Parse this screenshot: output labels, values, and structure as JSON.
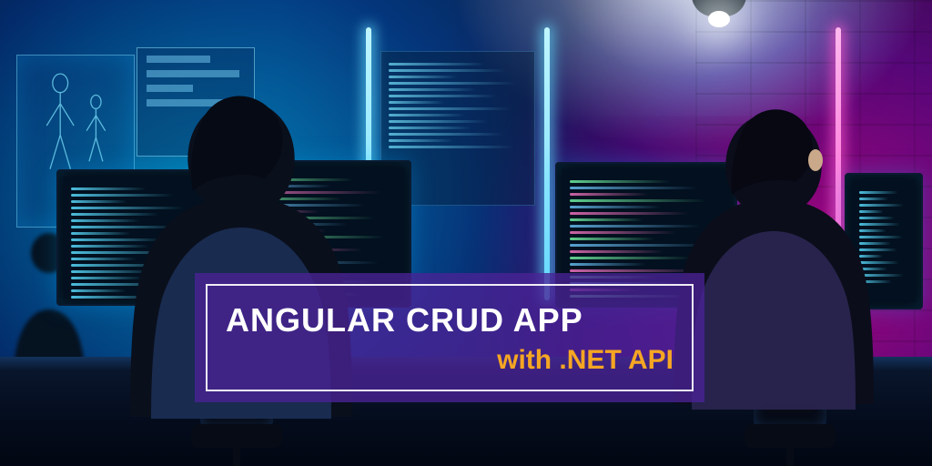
{
  "title": {
    "main": "ANGULAR CRUD APP",
    "sub": "with .NET API"
  },
  "colors": {
    "overlay_bg": "rgba(74,34,150,0.78)",
    "overlay_border": "#ffffff",
    "subtitle": "#f5a623"
  }
}
